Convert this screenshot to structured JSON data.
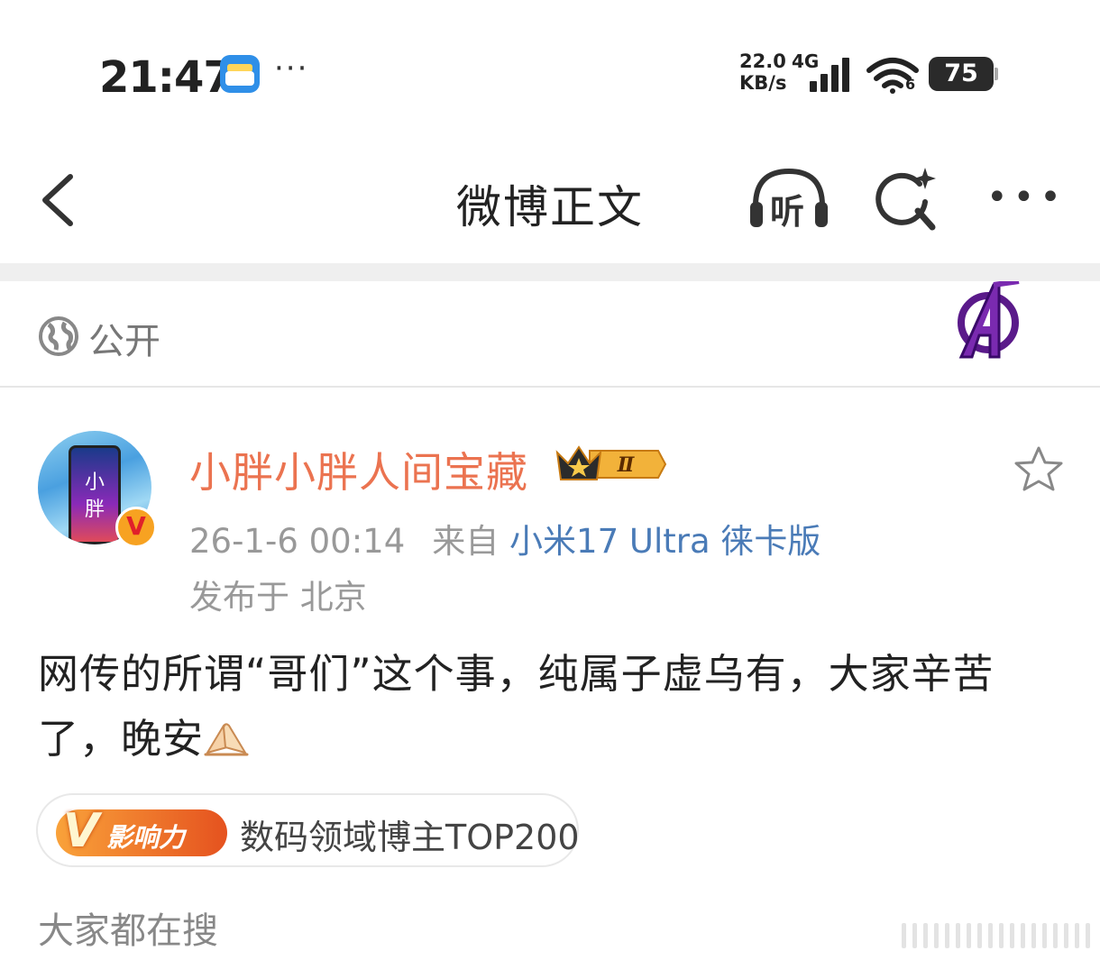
{
  "status_bar": {
    "time": "21:47",
    "app_icon": "wallet-icon",
    "overflow": "···",
    "net_speed_value": "22.0",
    "net_speed_unit": "KB/s",
    "net_type": "4G",
    "wifi_sub": "6",
    "battery": "75"
  },
  "nav": {
    "title": "微博正文",
    "listen_label": "听",
    "more_label": "•••"
  },
  "visibility": {
    "label": "公开"
  },
  "post": {
    "author": "小胖小胖人间宝藏",
    "avatar_text_1": "小",
    "avatar_text_2": "胖",
    "verified_mark": "V",
    "level_badge": "Ⅱ",
    "date": "26-1-6 00:14",
    "from_label": "来自",
    "source": "小米17 Ultra 徕卡版",
    "location": "发布于 北京",
    "body": "网传的所谓“哥们”这个事，纯属子虚乌有，大家辛苦了，晚安"
  },
  "influence": {
    "badge_v": "V",
    "badge_text": "影响力",
    "label": "数码领域博主TOP200"
  },
  "trending": {
    "title": "大家都在搜"
  },
  "colors": {
    "username": "#eb7350",
    "source_link": "#4a7bb7",
    "meta_gray": "#999999",
    "influence_gradient_start": "#f9a23a",
    "influence_gradient_end": "#e5521f"
  }
}
